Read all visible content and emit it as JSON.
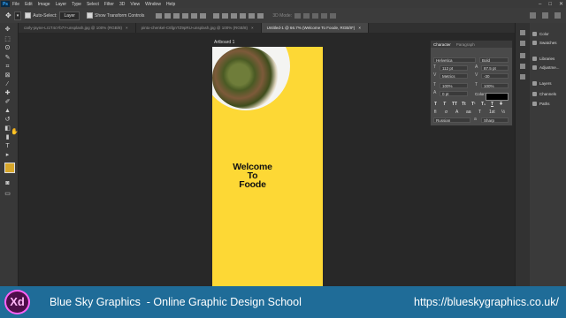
{
  "menubar": {
    "app_logo": "Ps",
    "items": [
      "File",
      "Edit",
      "Image",
      "Layer",
      "Type",
      "Select",
      "Filter",
      "3D",
      "View",
      "Window",
      "Help"
    ]
  },
  "optionsbar": {
    "auto_select_label": "Auto-Select:",
    "auto_select_value": "Layer",
    "show_transform_label": "Show Transform Controls",
    "mode_3d_label": "3D Mode:"
  },
  "tabs": [
    {
      "label": "carly-jayne-Lr1T4cYb7Y-unsplash.jpg @ 100% (RGB/8)",
      "active": false
    },
    {
      "label": "pinto-chenkel-C6fgnTZ9pRU-unsplash.jpg @ 100% (RGB/8)",
      "active": false
    },
    {
      "label": "Untitled-1 @ 66.7% (Welcome To Foode, RGB/8*)",
      "active": true
    }
  ],
  "canvas": {
    "artboard_label": "Artboard 1",
    "headline": [
      "Welcome",
      "To",
      "Foode"
    ],
    "artboard_color": "#fdd835"
  },
  "character_panel": {
    "tabs": [
      "Character",
      "Paragraph"
    ],
    "font_family": "Helvetica",
    "font_style": "Bold",
    "font_size": "112 pt",
    "leading": "87.5 pt",
    "kerning": "Metrics",
    "tracking": "-30",
    "vertical_scale": "100%",
    "horizontal_scale": "100%",
    "baseline_shift": "0 pt",
    "color_label": "Color:",
    "language": "Russian",
    "antialias": "Sharp",
    "type_buttons": [
      "T",
      "T",
      "TT",
      "Tt",
      "T¹",
      "T₁",
      "T",
      "T"
    ]
  },
  "right_panel": {
    "items": [
      "Color",
      "Swatches",
      "Libraries",
      "Adjustme...",
      "Layers",
      "Channels",
      "Paths"
    ]
  },
  "footer": {
    "logo": "Xd",
    "left_text": "Blue Sky Graphics  - Online Graphic Design School",
    "right_text": "https://blueskygraphics.co.uk/",
    "background": "#1f6c98"
  }
}
